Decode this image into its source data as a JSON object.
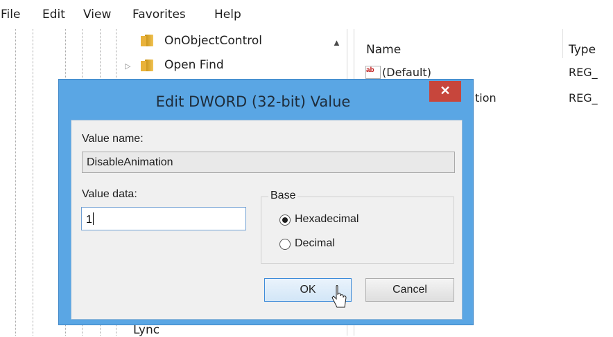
{
  "menu": {
    "items": [
      "File",
      "Edit",
      "View",
      "Favorites",
      "Help"
    ]
  },
  "tree": {
    "nodes": [
      {
        "label": "OnObjectControl"
      },
      {
        "label": "Open Find"
      }
    ],
    "partial_bottom_label": "Lync"
  },
  "list": {
    "columns": {
      "name": "Name",
      "type": "Type"
    },
    "rows": [
      {
        "name": "(Default)",
        "type": "REG_"
      },
      {
        "name_partial": "tion",
        "type": "REG_"
      }
    ],
    "string_value_icon_text": "ab"
  },
  "dialog": {
    "title": "Edit DWORD (32-bit) Value",
    "close_symbol": "✕",
    "value_name_label": "Value name:",
    "value_name": "DisableAnimation",
    "value_data_label": "Value data:",
    "value_data": "1",
    "base_label": "Base",
    "base_options": [
      {
        "label": "Hexadecimal",
        "selected": true
      },
      {
        "label": "Decimal",
        "selected": false
      }
    ],
    "ok_label": "OK",
    "cancel_label": "Cancel"
  },
  "colors": {
    "dialog_frame": "#5aa6e4",
    "close_button": "#c7463c",
    "dialog_body": "#f0f0f0",
    "ok_border": "#3c8bd9"
  }
}
